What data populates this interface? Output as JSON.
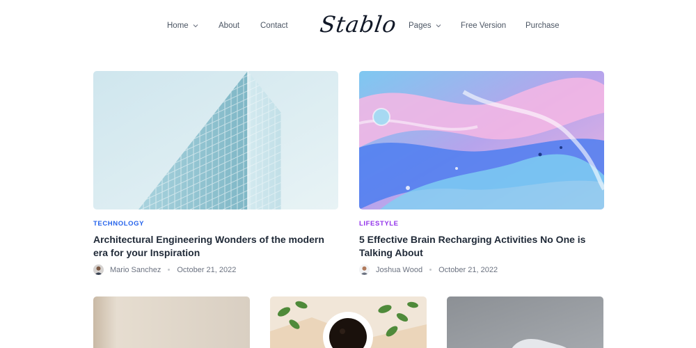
{
  "nav": {
    "left": [
      {
        "label": "Home",
        "has_dropdown": true
      },
      {
        "label": "About",
        "has_dropdown": false
      },
      {
        "label": "Contact",
        "has_dropdown": false
      }
    ],
    "logo": "Stablo",
    "right": [
      {
        "label": "Pages",
        "has_dropdown": true
      },
      {
        "label": "Free Version",
        "has_dropdown": false
      },
      {
        "label": "Purchase",
        "has_dropdown": false
      }
    ]
  },
  "posts": [
    {
      "category": "TECHNOLOGY",
      "category_color": "#2563eb",
      "title": "Architectural Engineering Wonders of the modern era for your Inspiration",
      "author": "Mario Sanchez",
      "date": "October 21, 2022",
      "image": "glass-building-photo"
    },
    {
      "category": "LIFESTYLE",
      "category_color": "#9333ea",
      "title": "5 Effective Brain Recharging Activities No One is Talking About",
      "author": "Joshua Wood",
      "date": "October 21, 2022",
      "image": "fluid-paint-photo"
    }
  ],
  "more_posts": [
    {
      "image": "beige-interior-photo"
    },
    {
      "image": "coffee-cup-leaves-photo"
    },
    {
      "image": "gray-sculpture-photo"
    }
  ]
}
